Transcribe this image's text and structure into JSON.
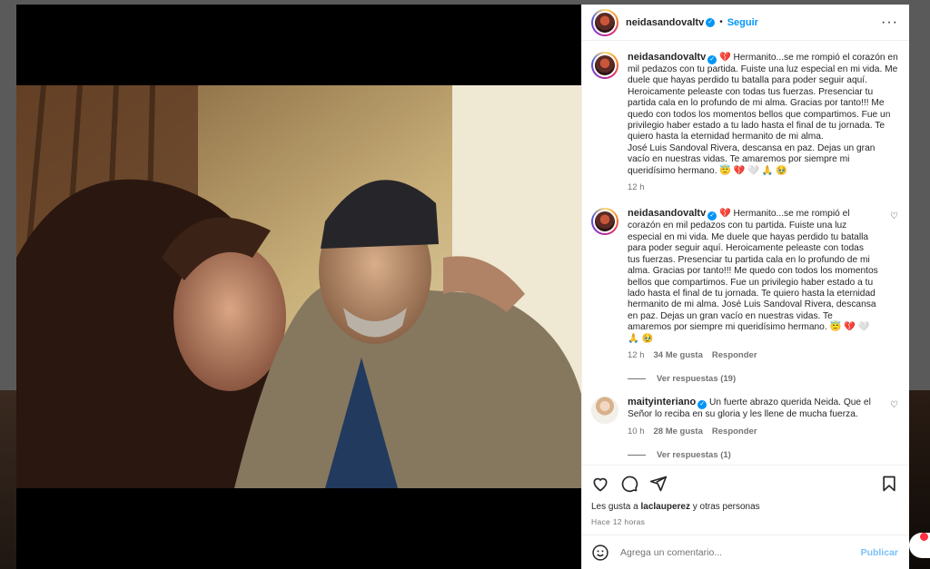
{
  "post": {
    "username": "neidasandovaltv",
    "follow_label": "Seguir",
    "dot": "•",
    "more": "···"
  },
  "comments": [
    {
      "username": "neidasandovaltv",
      "text": " 💔 Hermanito...se me rompió el corazón en mil pedazos con tu partida. Fuiste una luz especial en mi vida. Me duele que hayas perdido tu batalla para poder seguir aquí. Heroicamente peleaste con todas tus fuerzas. Presenciar tu partida cala en lo profundo de mi alma. Gracias por tanto!!! Me quedo con todos los momentos bellos que compartimos. Fue un privilegio haber estado a tu lado hasta el final de tu jornada. Te quiero hasta la eternidad hermanito de mi alma.\nJosé Luis Sandoval Rivera, descansa en paz. Dejas un gran vacío en nuestras vidas. Te amaremos por siempre mi queridísimo hermano. 😇 💔 🤍 🙏 🥹",
      "time": "12 h"
    },
    {
      "username": "neidasandovaltv",
      "text": " 💔 Hermanito...se me rompió el corazón en mil pedazos con tu partida. Fuiste una luz especial en mi vida. Me duele que hayas perdido tu batalla para poder seguir aquí. Heroicamente peleaste con todas tus fuerzas. Presenciar tu partida cala en lo profundo de mi alma. Gracias por tanto!!! Me quedo con todos los momentos bellos que compartimos. Fue un privilegio haber estado a tu lado hasta el final de tu jornada. Te quiero hasta la eternidad hermanito de mi alma. José Luis Sandoval Rivera, descansa en paz. Dejas un gran vacío en nuestras vidas. Te amaremos por siempre mi queridísimo hermano. 😇 💔 🤍 🙏 🥹",
      "time": "12 h",
      "likes": "34 Me gusta",
      "reply": "Responder",
      "view_replies": "Ver respuestas (19)"
    },
    {
      "username": "maityinteriano",
      "text": " Un fuerte abrazo querida Neida. Que el Señor lo reciba en su gloria y les llene de mucha fuerza.",
      "time": "10 h",
      "likes": "28 Me gusta",
      "reply": "Responder",
      "view_replies": "Ver respuestas (1)"
    }
  ],
  "footer": {
    "likes_prefix": "Les gusta a ",
    "likes_user": "laclauperez",
    "likes_suffix": " y otras personas",
    "time": "Hace 12 horas",
    "comment_placeholder": "Agrega un comentario...",
    "publish_label": "Publicar"
  },
  "colors": {
    "accent": "#0095f6",
    "publish_disabled": "#7ac0f8",
    "text": "#262626",
    "muted": "#737373"
  },
  "icons": [
    "heart-icon",
    "comment-icon",
    "share-icon",
    "bookmark-icon",
    "emoji-icon",
    "more-icon",
    "verified-icon"
  ]
}
